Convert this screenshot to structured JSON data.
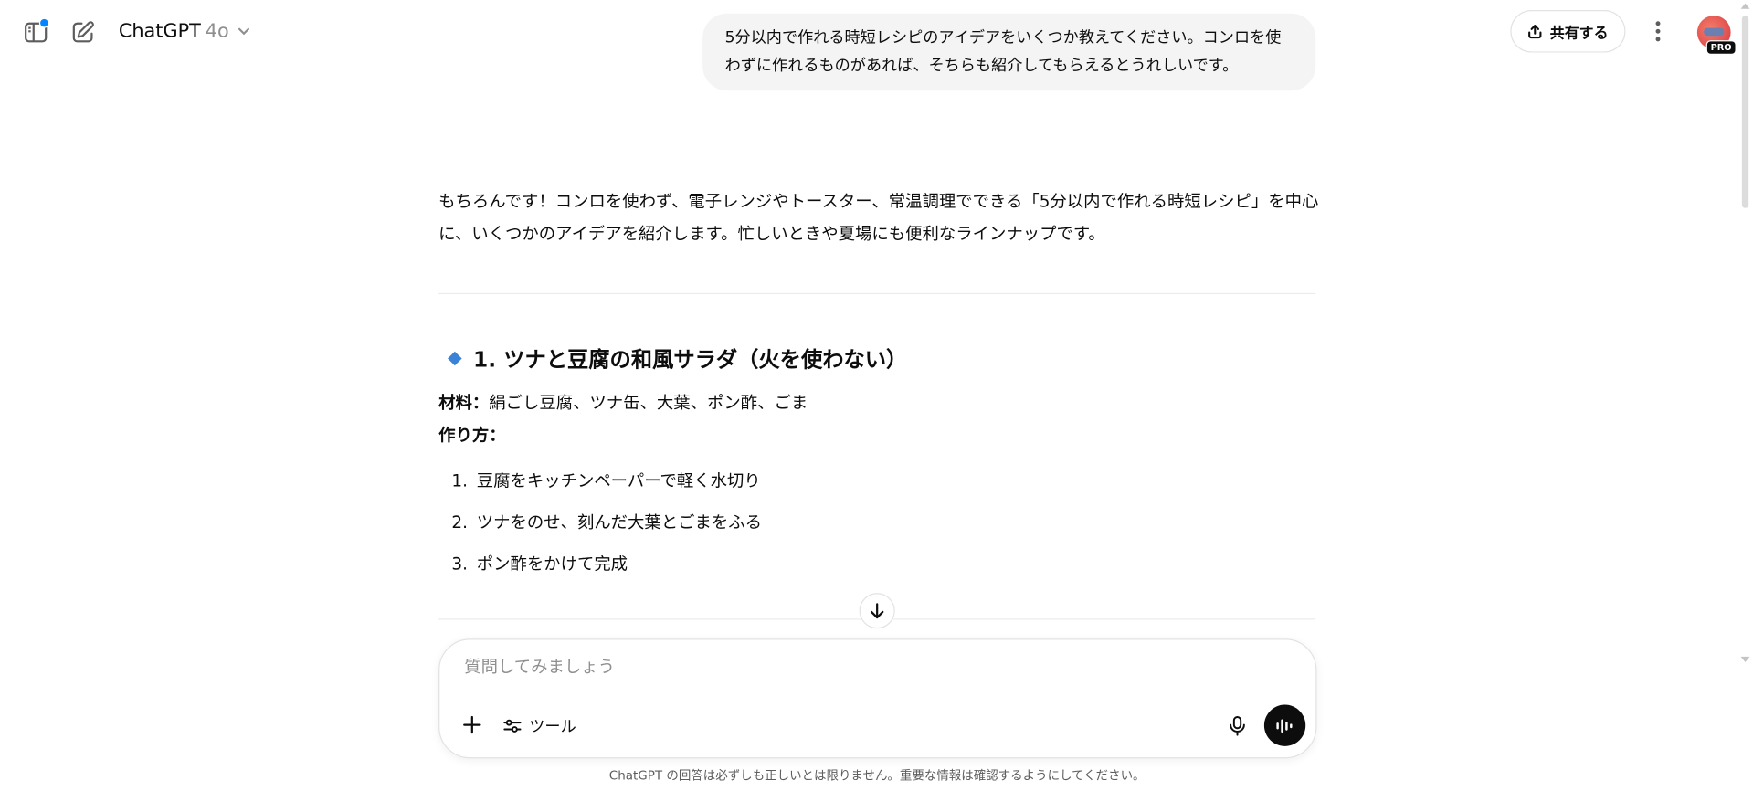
{
  "header": {
    "model_name": "ChatGPT",
    "model_version": "4o",
    "share_label": "共有する"
  },
  "user_message": "5分以内で作れる時短レシピのアイデアをいくつか教えてください。コンロを使わずに作れるものがあれば、そちらも紹介してもらえるとうれしいです。",
  "assistant": {
    "intro": "もちろんです！コンロを使わず、電子レンジやトースター、常温調理でできる「5分以内で作れる時短レシピ」を中心に、いくつかのアイデアを紹介します。忙しいときや夏場にも便利なラインナップです。",
    "recipe1": {
      "title": "1. ツナと豆腐の和風サラダ（火を使わない）",
      "ingredients_label": "材料：",
      "ingredients": "絹ごし豆腐、ツナ缶、大葉、ポン酢、ごま",
      "method_label": "作り方：",
      "steps": [
        {
          "num": "1.",
          "text": "豆腐をキッチンペーパーで軽く水切り"
        },
        {
          "num": "2.",
          "text": "ツナをのせ、刻んだ大葉とごまをふる"
        },
        {
          "num": "3.",
          "text": "ポン酢をかけて完成"
        }
      ]
    }
  },
  "composer": {
    "placeholder": "質問してみましょう",
    "tools_label": "ツール"
  },
  "disclaimer": "ChatGPT の回答は必ずしも正しいとは限りません。重要な情報は確認するようにしてください。",
  "avatar": {
    "badge": "PRO"
  },
  "colors": {
    "accent_dot": "#0285ff",
    "diamond": "#3a82d6",
    "user_bubble": "#f4f4f4",
    "voice_button": "#0d0d0d"
  }
}
